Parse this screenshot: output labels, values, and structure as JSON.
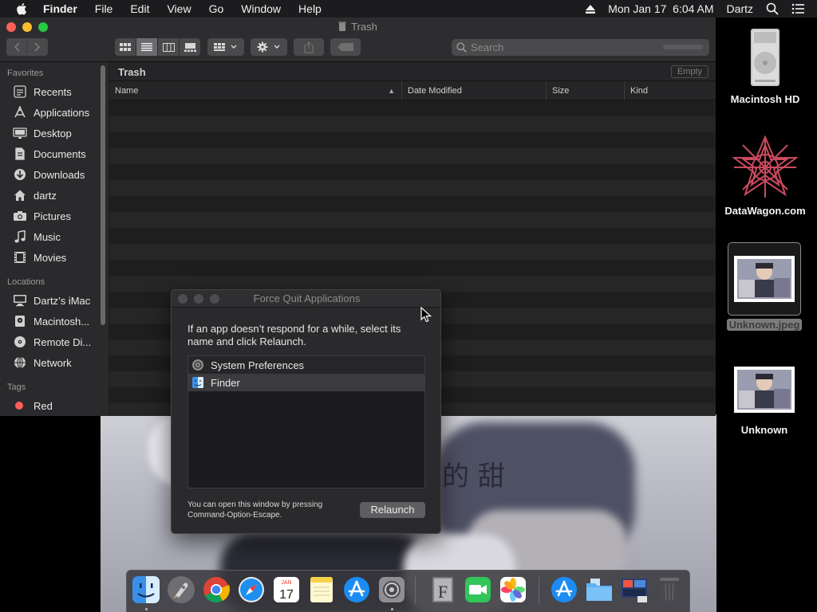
{
  "menubar": {
    "app_name": "Finder",
    "items": [
      "File",
      "Edit",
      "View",
      "Go",
      "Window",
      "Help"
    ],
    "datetime": "Mon Jan 17  6:04 AM",
    "user": "Dartz",
    "icons": [
      "apple-icon",
      "eject-icon",
      "spotlight-icon",
      "notification-center-icon"
    ]
  },
  "finder": {
    "title": "Trash",
    "search_placeholder": "Search",
    "path_label": "Trash",
    "empty_button": "Empty",
    "columns": [
      "Name",
      "Date Modified",
      "Size",
      "Kind"
    ],
    "sidebar": {
      "favorites_header": "Favorites",
      "favorites": [
        {
          "label": "Recents",
          "icon": "clock-icon"
        },
        {
          "label": "Applications",
          "icon": "applications-icon"
        },
        {
          "label": "Desktop",
          "icon": "desktop-icon"
        },
        {
          "label": "Documents",
          "icon": "document-icon"
        },
        {
          "label": "Downloads",
          "icon": "download-icon"
        },
        {
          "label": "dartz",
          "icon": "home-icon"
        },
        {
          "label": "Pictures",
          "icon": "camera-icon"
        },
        {
          "label": "Music",
          "icon": "music-note-icon"
        },
        {
          "label": "Movies",
          "icon": "film-icon"
        }
      ],
      "locations_header": "Locations",
      "locations": [
        {
          "label": "Dartz’s iMac",
          "icon": "computer-icon"
        },
        {
          "label": "Macintosh...",
          "icon": "hard-drive-icon"
        },
        {
          "label": "Remote Di...",
          "icon": "disc-icon"
        },
        {
          "label": "Network",
          "icon": "globe-icon"
        }
      ],
      "tags_header": "Tags",
      "tags": [
        {
          "label": "Red",
          "color": "#fe5f57"
        }
      ]
    }
  },
  "desktop": {
    "icons": [
      {
        "label": "Macintosh HD",
        "icon": "hard-drive-icon"
      },
      {
        "label": "DataWagon.com",
        "icon": "mandala-image-icon"
      },
      {
        "label": "Unknown.jpeg",
        "icon": "photo-thumbnail-icon",
        "selected": true
      },
      {
        "label": "Unknown",
        "icon": "photo-thumbnail-icon"
      }
    ]
  },
  "force_quit": {
    "title": "Force Quit Applications",
    "message": "If an app doesn’t respond for a while, select its name and click Relaunch.",
    "apps": [
      {
        "name": "System Preferences",
        "icon": "gear-icon"
      },
      {
        "name": "Finder",
        "icon": "finder-icon",
        "selected": true
      }
    ],
    "hint": "You can open this window by pressing Command-Option-Escape.",
    "button": "Relaunch"
  },
  "wallpaper": {
    "glyph": "的 甜"
  },
  "dock": {
    "apps": [
      "Finder",
      "Launchpad",
      "Chrome",
      "Safari",
      "Calendar",
      "Notes",
      "App Store",
      "System Preferences",
      "Font Book",
      "FaceTime",
      "Photos",
      "App Store",
      "Folder",
      "Screenshot",
      "Trash"
    ],
    "calendar_month": "JAN",
    "calendar_day": "17"
  },
  "colors": {
    "accent_red": "#fe5f57",
    "accent_yellow": "#febc2e",
    "accent_green": "#28c840",
    "finder_bg": "#1e1e1e"
  }
}
